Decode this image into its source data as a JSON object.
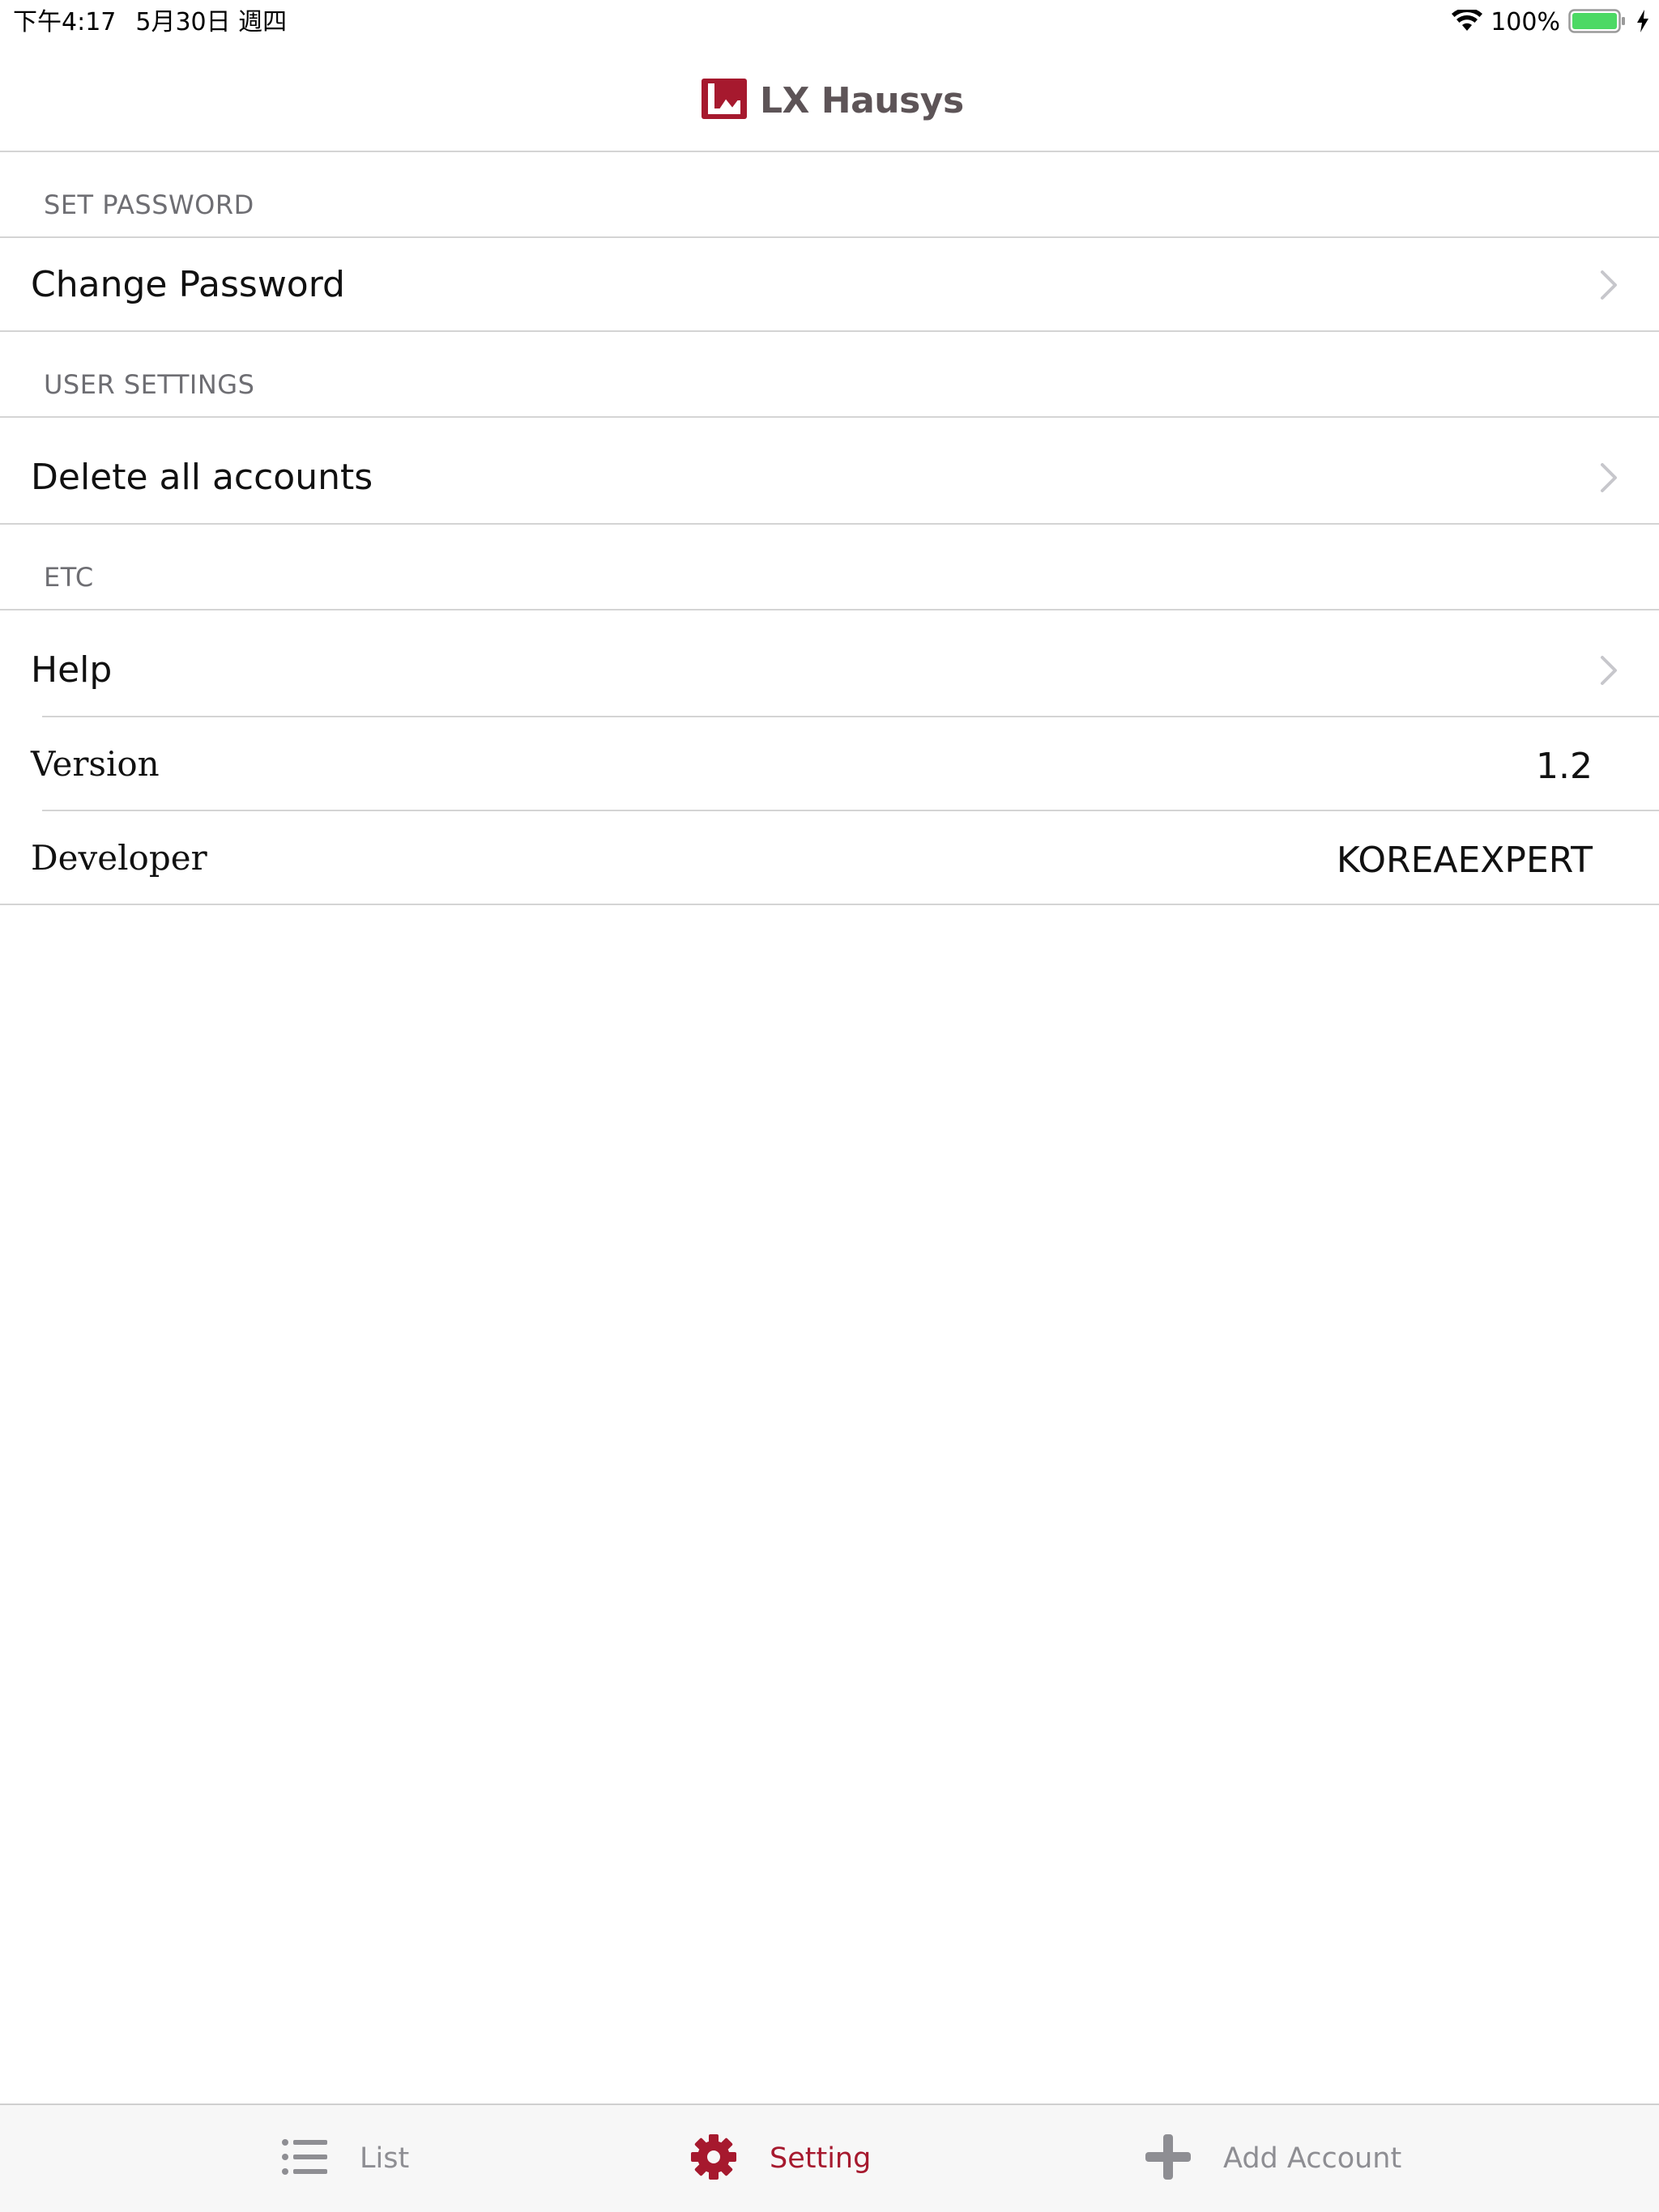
{
  "status_bar": {
    "time": "下午4:17",
    "date": "5月30日 週四",
    "battery_percent": "100%",
    "battery_level": 1.0,
    "charging": true
  },
  "header": {
    "logo_text": "LX Hausys",
    "brand_color": "#a6192e"
  },
  "sections": {
    "set_password": {
      "title": "SET PASSWORD",
      "rows": [
        {
          "label": "Change Password",
          "has_chevron": true
        }
      ]
    },
    "user_settings": {
      "title": "USER SETTINGS",
      "rows": [
        {
          "label": "Delete all accounts",
          "has_chevron": true
        }
      ]
    },
    "etc": {
      "title": "ETC",
      "rows": [
        {
          "label": "Help",
          "has_chevron": true
        },
        {
          "label": "Version",
          "value": "1.2"
        },
        {
          "label": "Developer",
          "value": "KOREAEXPERT"
        }
      ]
    }
  },
  "tab_bar": {
    "tabs": [
      {
        "label": "List",
        "icon": "list-icon",
        "active": false
      },
      {
        "label": "Setting",
        "icon": "gear-icon",
        "active": true
      },
      {
        "label": "Add Account",
        "icon": "plus-icon",
        "active": false
      }
    ],
    "active_color": "#a6192e",
    "inactive_color": "#8e8e93"
  }
}
